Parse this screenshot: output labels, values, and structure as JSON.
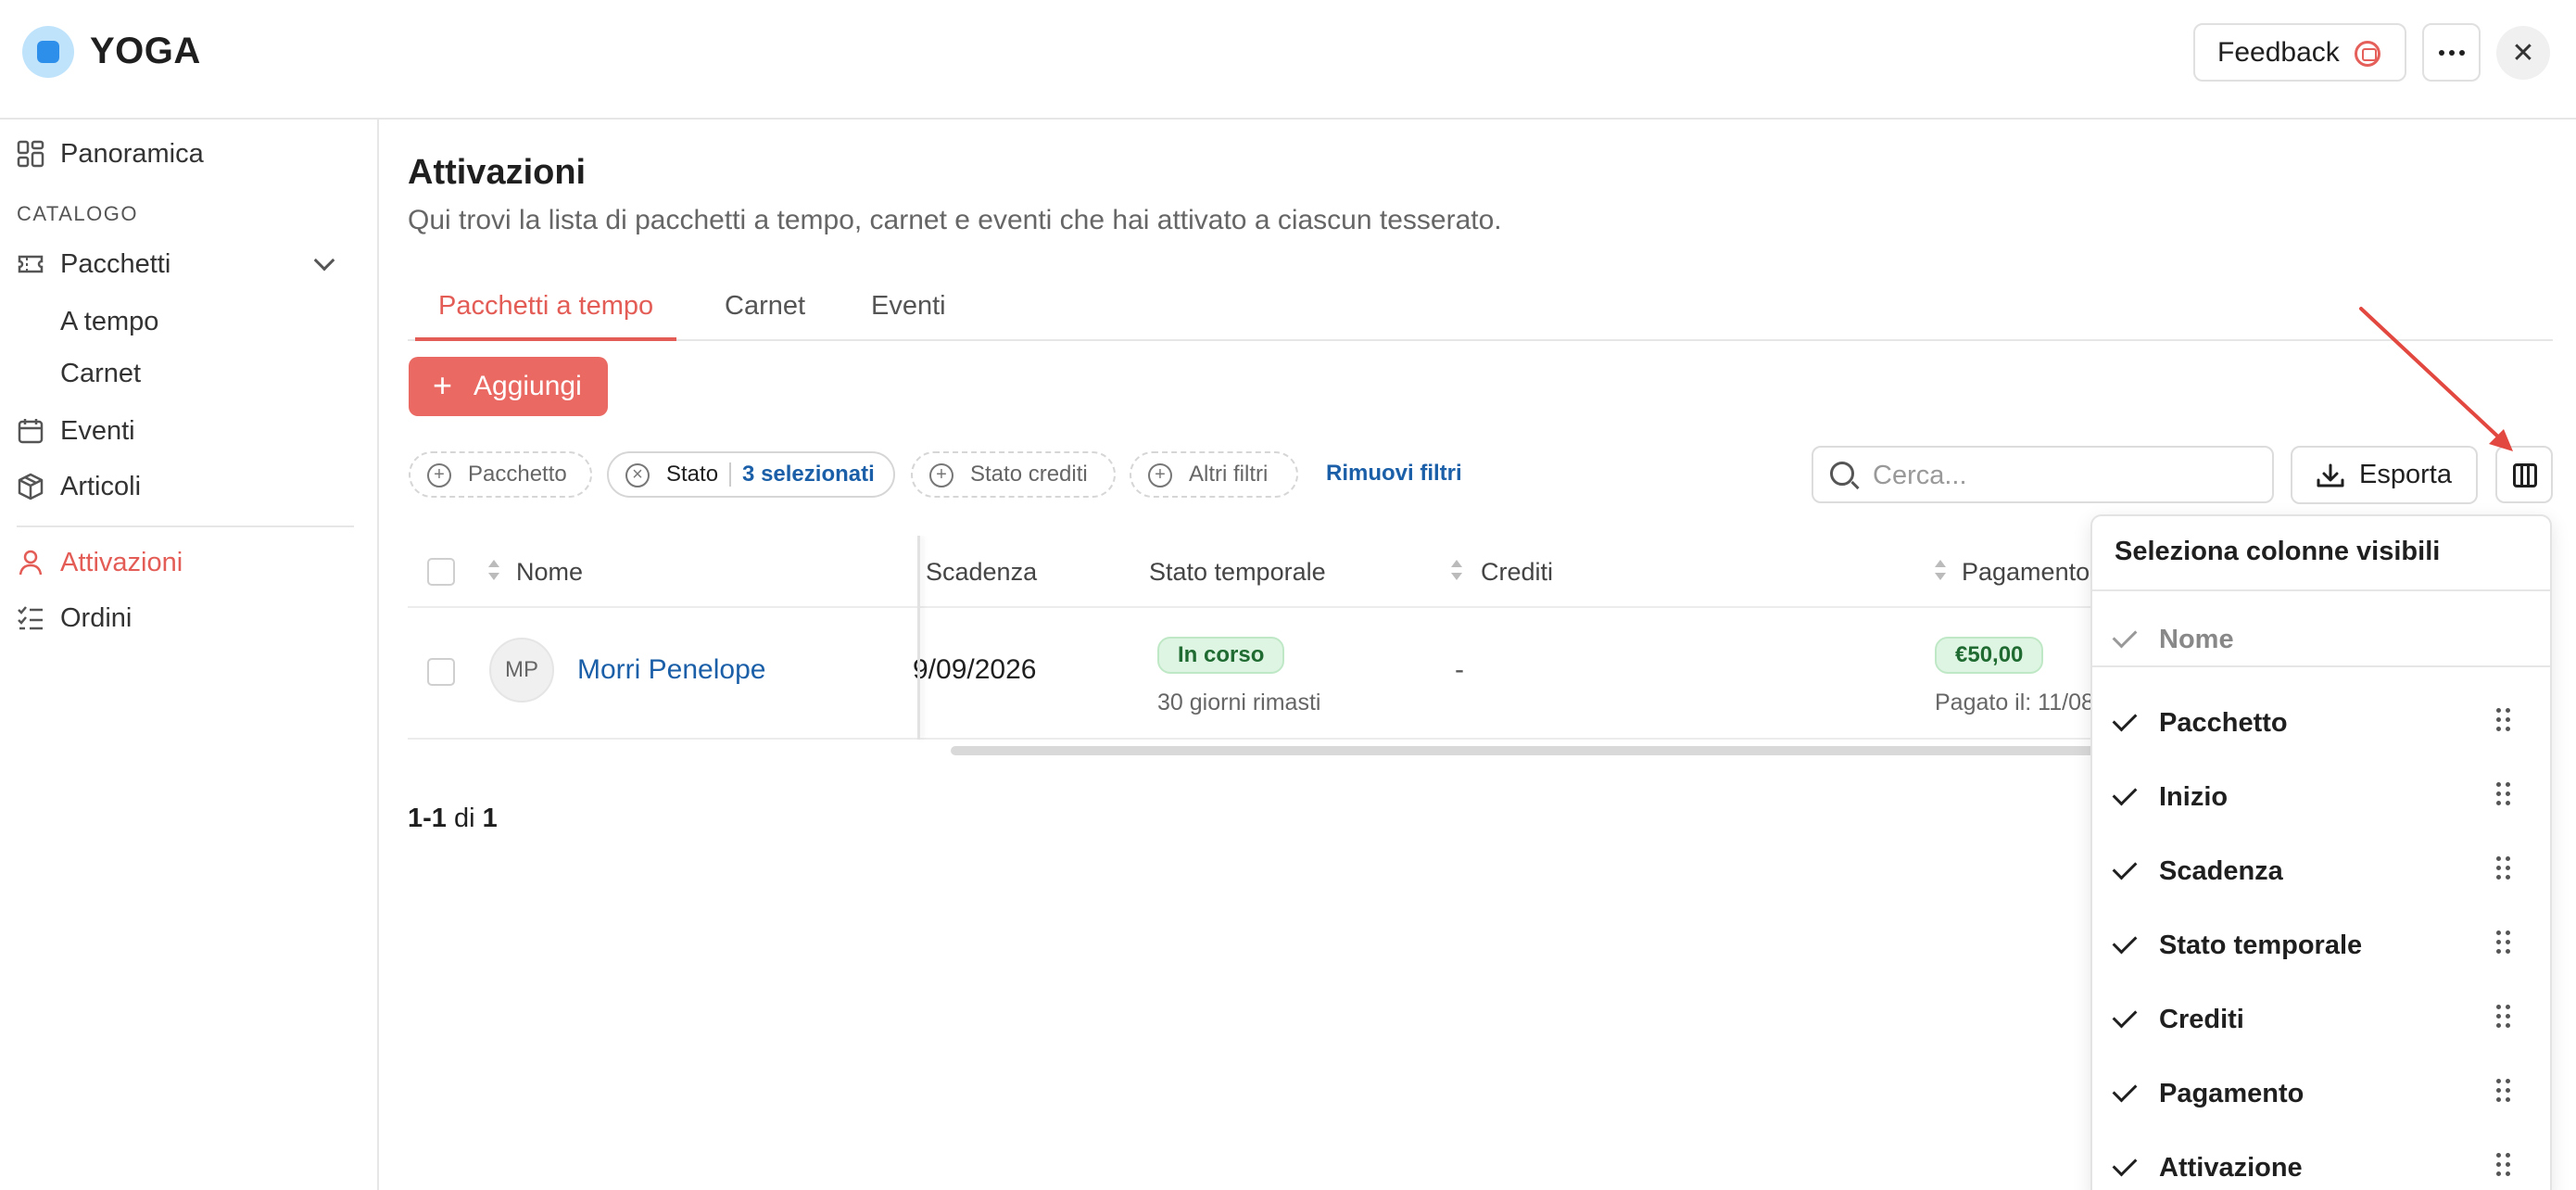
{
  "app": {
    "title": "YOGA",
    "feedback_label": "Feedback"
  },
  "sidebar": {
    "overview": "Panoramica",
    "section_catalog": "CATALOGO",
    "packages": "Pacchetti",
    "sub_time": "A tempo",
    "sub_carnet": "Carnet",
    "events": "Eventi",
    "articles": "Articoli",
    "activations": "Attivazioni",
    "orders": "Ordini"
  },
  "page": {
    "title": "Attivazioni",
    "subtitle": "Qui trovi la lista di pacchetti a tempo, carnet e eventi che hai attivato a ciascun tesserato."
  },
  "tabs": [
    "Pacchetti a tempo",
    "Carnet",
    "Eventi"
  ],
  "toolbar": {
    "add_label": "Aggiungi",
    "filter_package": "Pacchetto",
    "filter_status": "Stato",
    "filter_status_selected": "3 selezionati",
    "filter_credit_status": "Stato crediti",
    "filter_other": "Altri filtri",
    "remove_filters": "Rimuovi filtri",
    "search_placeholder": "Cerca...",
    "export_label": "Esporta"
  },
  "table": {
    "headers": {
      "name": "Nome",
      "expiry": "Scadenza",
      "time_status": "Stato temporale",
      "credits": "Crediti",
      "payment": "Pagamento"
    },
    "rows": [
      {
        "initials": "MP",
        "name": "Morri Penelope",
        "expiry": "9/09/2026",
        "status_badge": "In corso",
        "status_detail": "30 giorni rimasti",
        "credits": "-",
        "payment_badge": "€50,00",
        "payment_detail": "Pagato il: 11/08"
      }
    ]
  },
  "pagination": {
    "range": "1-1",
    "of": "di",
    "total": "1"
  },
  "columns_panel": {
    "title": "Seleziona colonne visibili",
    "items": [
      {
        "label": "Nome",
        "checked": true,
        "locked": true
      },
      {
        "label": "Pacchetto",
        "checked": true
      },
      {
        "label": "Inizio",
        "checked": true
      },
      {
        "label": "Scadenza",
        "checked": true
      },
      {
        "label": "Stato temporale",
        "checked": true
      },
      {
        "label": "Crediti",
        "checked": true
      },
      {
        "label": "Pagamento",
        "checked": true
      },
      {
        "label": "Attivazione",
        "checked": true
      }
    ]
  },
  "colors": {
    "accent": "#e35c55",
    "link": "#1a5fa8",
    "success_bg": "#dff5e3",
    "success_text": "#1f6b31"
  }
}
